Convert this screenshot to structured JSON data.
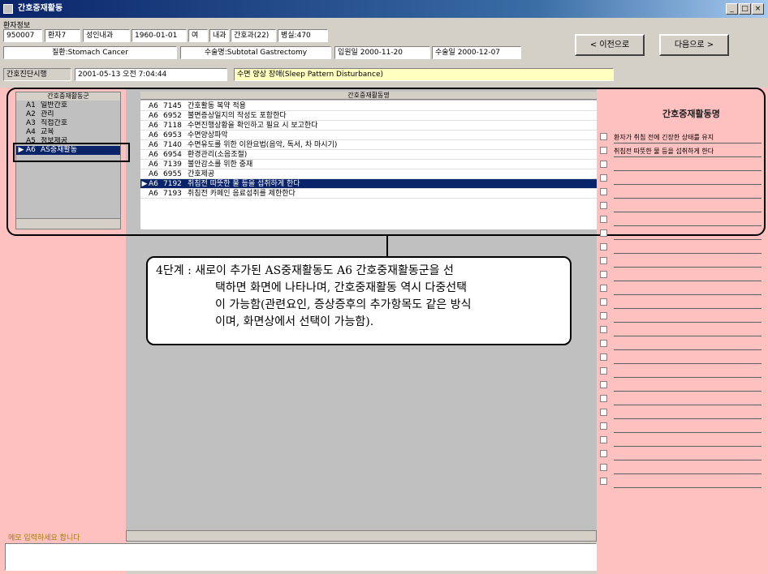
{
  "window": {
    "title": "간호중재활동",
    "min": "_",
    "max": "□",
    "close": "×"
  },
  "patient_label": "환자정보",
  "patient": {
    "id": "950007",
    "name": "환자7",
    "ward": "성인내과",
    "birth": "1960-01-01",
    "sex": "여",
    "dept": "내과",
    "unit": "간호과(22)",
    "room": "병실:470"
  },
  "diagnosis": {
    "label": "질환:",
    "value": "Stomach Cancer"
  },
  "surgery": {
    "label": "수술명:",
    "value": "Subtotal Gastrectomy"
  },
  "admit": {
    "label": "입원일",
    "value": "2000-11-20"
  },
  "surgdate": {
    "label": "수술일",
    "value": "2000-12-07"
  },
  "nav": {
    "prev": "< 이전으로",
    "next": "다음으로 >"
  },
  "assess_label": "간호진단시행",
  "assess_datetime": "2001-05-13 오전 7:04:44",
  "nursing_dx": "수면 양상 장애(Sleep Pattern Disturbance)",
  "left": {
    "header": "간호중재활동군",
    "items": [
      {
        "code": "A1",
        "label": "일반간호"
      },
      {
        "code": "A2",
        "label": "관리"
      },
      {
        "code": "A3",
        "label": "직접간호"
      },
      {
        "code": "A4",
        "label": "교육"
      },
      {
        "code": "A5",
        "label": "정보제공"
      },
      {
        "code": "A6",
        "label": "AS중재활동"
      }
    ],
    "selected_marker": "▶"
  },
  "middle": {
    "header": "간호중재활동명",
    "rows": [
      {
        "g": "A6",
        "c": "7145",
        "t": "간호활동 복약 적용"
      },
      {
        "g": "A6",
        "c": "6952",
        "t": "불면증상일지의 작성도 포함한다"
      },
      {
        "g": "A6",
        "c": "7118",
        "t": "수면진행상황을 확인하고 필요 시 보고한다"
      },
      {
        "g": "A6",
        "c": "6953",
        "t": "수면양상파악"
      },
      {
        "g": "A6",
        "c": "7140",
        "t": "수면유도를 위한 이완요법(음악, 독서, 차 마시기)"
      },
      {
        "g": "A6",
        "c": "6954",
        "t": "환경관리(소음조절)"
      },
      {
        "g": "A6",
        "c": "7139",
        "t": "불안감소를 위한 중재"
      },
      {
        "g": "A6",
        "c": "6955",
        "t": "간호제공"
      },
      {
        "g": "A6",
        "c": "7192",
        "t": "취침전 따뜻한 물 등을 섭취하게 한다"
      },
      {
        "g": "A6",
        "c": "7193",
        "t": "취침전 카페인 음료섭취를 제한한다"
      }
    ],
    "selected_index": 8,
    "selected_marker": "▶"
  },
  "right": {
    "header": "간호중재활동명",
    "items": [
      "환자가 취침 전에 긴장한 상태를 유지",
      "취침전 따뜻한 물 등을 섭취하게 한다"
    ]
  },
  "callout": {
    "line1": "4단계 : 새로이 추가된 AS중재활동도 A6 간호중재활동군을 선",
    "line2": "택하면 화면에 나타나며, 간호중재활동 역시 다중선택",
    "line3": "이 가능함(관련요인, 증상증후의 추가항목도 같은 방식",
    "line4": "이며, 화면상에서 선택이 가능함)."
  },
  "bottom_label": "메모 입력하세요 합니다",
  "colors": {
    "pink": "#ffc0c0",
    "gray": "#c0c0c0",
    "selection": "#0a246a",
    "highlight": "#ffffc0"
  }
}
